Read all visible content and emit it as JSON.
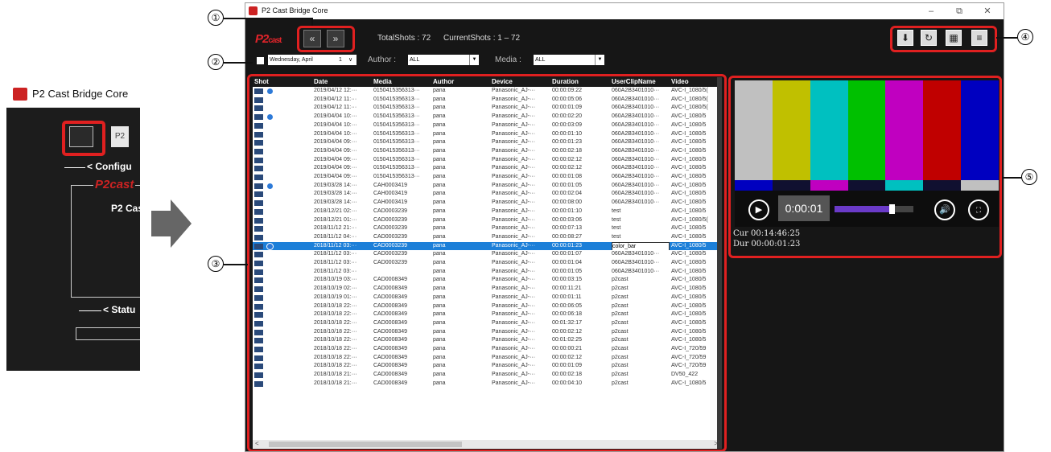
{
  "small_window": {
    "title": "P2 Cast Bridge Core",
    "p2_button": "P2",
    "config_heading": "< Configu",
    "logo": "P2cast",
    "p2cast_label": "P2 Cas",
    "status_heading": "< Statu"
  },
  "main_window": {
    "title": "P2 Cast Bridge Core",
    "minimize": "–",
    "restore": "⧉",
    "close": "✕"
  },
  "header": {
    "logo_main": "P2",
    "logo_sub": "cast",
    "prev_label": "«",
    "next_label": "»",
    "total_shots": "TotalShots :  72",
    "current_shots": "CurrentShots :  1 – 72"
  },
  "filters": {
    "date_value": "Wednesday,     April",
    "date_day": "1",
    "date_arrow": "∨",
    "author_label": "Author :",
    "author_value": "ALL",
    "media_label": "Media :",
    "media_value": "ALL",
    "combo_arrow": "▼"
  },
  "toolbar": {
    "download_icon": "⬇",
    "refresh_icon": "↻",
    "grid_icon": "▦",
    "list_icon": "≡"
  },
  "table": {
    "columns": [
      "Shot",
      "Date",
      "Media",
      "Author",
      "Device",
      "Duration",
      "UserClipName",
      "Video"
    ],
    "rows": [
      {
        "dl": true,
        "date": "2019/04/12 12:···",
        "media": "0150415356313···",
        "author": "pana",
        "device": "Panasonic_AJ-···",
        "duration": "00:00:09:22",
        "clip": "060A2B3401010···",
        "video": "AVC-I_1080/5("
      },
      {
        "dl": false,
        "date": "2019/04/12 11:···",
        "media": "0150415356313···",
        "author": "pana",
        "device": "Panasonic_AJ-···",
        "duration": "00:00:05:06",
        "clip": "060A2B3401010···",
        "video": "AVC-I_1080/5("
      },
      {
        "dl": false,
        "date": "2019/04/12 11:···",
        "media": "0150415356313···",
        "author": "pana",
        "device": "Panasonic_AJ-···",
        "duration": "00:00:01:09",
        "clip": "060A2B3401010···",
        "video": "AVC-I_1080/5("
      },
      {
        "dl": true,
        "date": "2019/04/04 10:···",
        "media": "0150415356313···",
        "author": "pana",
        "device": "Panasonic_AJ-···",
        "duration": "00:00:02:20",
        "clip": "060A2B3401010···",
        "video": "AVC-I_1080/5"
      },
      {
        "dl": false,
        "date": "2019/04/04 10:···",
        "media": "0150415356313···",
        "author": "pana",
        "device": "Panasonic_AJ-···",
        "duration": "00:00:03:09",
        "clip": "060A2B3401010···",
        "video": "AVC-I_1080/5"
      },
      {
        "dl": false,
        "date": "2019/04/04 10:···",
        "media": "0150415356313···",
        "author": "pana",
        "device": "Panasonic_AJ-···",
        "duration": "00:00:01:10",
        "clip": "060A2B3401010···",
        "video": "AVC-I_1080/5"
      },
      {
        "dl": false,
        "date": "2019/04/04 09:···",
        "media": "0150415356313···",
        "author": "pana",
        "device": "Panasonic_AJ-···",
        "duration": "00:00:01:23",
        "clip": "060A2B3401010···",
        "video": "AVC-I_1080/5"
      },
      {
        "dl": false,
        "date": "2019/04/04 09:···",
        "media": "0150415356313···",
        "author": "pana",
        "device": "Panasonic_AJ-···",
        "duration": "00:00:02:18",
        "clip": "060A2B3401010···",
        "video": "AVC-I_1080/5"
      },
      {
        "dl": false,
        "date": "2019/04/04 09:···",
        "media": "0150415356313···",
        "author": "pana",
        "device": "Panasonic_AJ-···",
        "duration": "00:00:02:12",
        "clip": "060A2B3401010···",
        "video": "AVC-I_1080/5"
      },
      {
        "dl": false,
        "date": "2019/04/04 09:···",
        "media": "0150415356313···",
        "author": "pana",
        "device": "Panasonic_AJ-···",
        "duration": "00:00:02:12",
        "clip": "060A2B3401010···",
        "video": "AVC-I_1080/5"
      },
      {
        "dl": false,
        "date": "2019/04/04 09:···",
        "media": "0150415356313···",
        "author": "pana",
        "device": "Panasonic_AJ-···",
        "duration": "00:00:01:08",
        "clip": "060A2B3401010···",
        "video": "AVC-I_1080/5"
      },
      {
        "dl": true,
        "date": "2019/03/28 14:···",
        "media": "CAH0003419",
        "author": "pana",
        "device": "Panasonic_AJ-···",
        "duration": "00:00:01:05",
        "clip": "060A2B3401010···",
        "video": "AVC-I_1080/5"
      },
      {
        "dl": false,
        "date": "2019/03/28 14:···",
        "media": "CAH0003419",
        "author": "pana",
        "device": "Panasonic_AJ-···",
        "duration": "00:00:02:04",
        "clip": "060A2B3401010···",
        "video": "AVC-I_1080/5"
      },
      {
        "dl": false,
        "date": "2019/03/28 14:···",
        "media": "CAH0003419",
        "author": "pana",
        "device": "Panasonic_AJ-···",
        "duration": "00:00:08:00",
        "clip": "060A2B3401010···",
        "video": "AVC-I_1080/5"
      },
      {
        "dl": false,
        "date": "2018/12/21 02:···",
        "media": "CAD0003239",
        "author": "pana",
        "device": "Panasonic_AJ-···",
        "duration": "00:00:01:10",
        "clip": "test",
        "video": "AVC-I_1080/5"
      },
      {
        "dl": false,
        "date": "2018/12/21 01:···",
        "media": "CAD0003239",
        "author": "pana",
        "device": "Panasonic_AJ-···",
        "duration": "00:00:03:06",
        "clip": "test",
        "video": "AVC-I_1080/5("
      },
      {
        "dl": false,
        "date": "2018/11/12 21:···",
        "media": "CAD0003239",
        "author": "pana",
        "device": "Panasonic_AJ-···",
        "duration": "00:00:07:13",
        "clip": "test",
        "video": "AVC-I_1080/5"
      },
      {
        "dl": false,
        "date": "2018/11/12 04:···",
        "media": "CAD0003239",
        "author": "pana",
        "device": "Panasonic_AJ-···",
        "duration": "00:00:08:27",
        "clip": "test",
        "video": "AVC-I_1080/5"
      },
      {
        "dl": true,
        "sel": true,
        "date": "2018/11/12 03:···",
        "media": "CAD0003239",
        "author": "pana",
        "device": "Panasonic_AJ-···",
        "duration": "00:00:01:23",
        "clip": "color_bar",
        "video": "AVC-I_1080/5"
      },
      {
        "dl": false,
        "date": "2018/11/12 03:···",
        "media": "CAD0003239",
        "author": "pana",
        "device": "Panasonic_AJ-···",
        "duration": "00:00:01:07",
        "clip": "060A2B3401010···",
        "video": "AVC-I_1080/5"
      },
      {
        "dl": false,
        "date": "2018/11/12 03:···",
        "media": "CAD0003239",
        "author": "pana",
        "device": "Panasonic_AJ-···",
        "duration": "00:00:01:04",
        "clip": "060A2B3401010···",
        "video": "AVC-I_1080/5"
      },
      {
        "dl": false,
        "date": "2018/11/12 03:···",
        "media": "",
        "author": "pana",
        "device": "Panasonic_AJ-···",
        "duration": "00:00:01:05",
        "clip": "060A2B3401010···",
        "video": "AVC-I_1080/5"
      },
      {
        "dl": false,
        "date": "2018/10/19 03:···",
        "media": "CAD0008349",
        "author": "pana",
        "device": "Panasonic_AJ-···",
        "duration": "00:00:03:15",
        "clip": "p2cast",
        "video": "AVC-I_1080/5"
      },
      {
        "dl": false,
        "date": "2018/10/19 02:···",
        "media": "CAD0008349",
        "author": "pana",
        "device": "Panasonic_AJ-···",
        "duration": "00:00:11:21",
        "clip": "p2cast",
        "video": "AVC-I_1080/5"
      },
      {
        "dl": false,
        "date": "2018/10/19 01:···",
        "media": "CAD0008349",
        "author": "pana",
        "device": "Panasonic_AJ-···",
        "duration": "00:00:01:11",
        "clip": "p2cast",
        "video": "AVC-I_1080/5"
      },
      {
        "dl": false,
        "date": "2018/10/18 22:···",
        "media": "CAD0008349",
        "author": "pana",
        "device": "Panasonic_AJ-···",
        "duration": "00:00:06:05",
        "clip": "p2cast",
        "video": "AVC-I_1080/5"
      },
      {
        "dl": false,
        "date": "2018/10/18 22:···",
        "media": "CAD0008349",
        "author": "pana",
        "device": "Panasonic_AJ-···",
        "duration": "00:00:06:18",
        "clip": "p2cast",
        "video": "AVC-I_1080/5"
      },
      {
        "dl": false,
        "date": "2018/10/18 22:···",
        "media": "CAD0008349",
        "author": "pana",
        "device": "Panasonic_AJ-···",
        "duration": "00:01:32:17",
        "clip": "p2cast",
        "video": "AVC-I_1080/5"
      },
      {
        "dl": false,
        "date": "2018/10/18 22:···",
        "media": "CAD0008349",
        "author": "pana",
        "device": "Panasonic_AJ-···",
        "duration": "00:00:02:12",
        "clip": "p2cast",
        "video": "AVC-I_1080/5"
      },
      {
        "dl": false,
        "date": "2018/10/18 22:···",
        "media": "CAD0008349",
        "author": "pana",
        "device": "Panasonic_AJ-···",
        "duration": "00:01:02:25",
        "clip": "p2cast",
        "video": "AVC-I_1080/5"
      },
      {
        "dl": false,
        "date": "2018/10/18 22:···",
        "media": "CAD0008349",
        "author": "pana",
        "device": "Panasonic_AJ-···",
        "duration": "00:00:00:21",
        "clip": "p2cast",
        "video": "AVC-I_720/59"
      },
      {
        "dl": false,
        "date": "2018/10/18 22:···",
        "media": "CAD0008349",
        "author": "pana",
        "device": "Panasonic_AJ-···",
        "duration": "00:00:02:12",
        "clip": "p2cast",
        "video": "AVC-I_720/59"
      },
      {
        "dl": false,
        "date": "2018/10/18 22:···",
        "media": "CAD0008349",
        "author": "pana",
        "device": "Panasonic_AJ-···",
        "duration": "00:00:01:09",
        "clip": "p2cast",
        "video": "AVC-I_720/59"
      },
      {
        "dl": false,
        "date": "2018/10/18 21:···",
        "media": "CAD0008349",
        "author": "pana",
        "device": "Panasonic_AJ-···",
        "duration": "00:00:02:18",
        "clip": "p2cast",
        "video": "DV50_422"
      },
      {
        "dl": false,
        "date": "2018/10/18 21:···",
        "media": "CAD0008349",
        "author": "pana",
        "device": "Panasonic_AJ-···",
        "duration": "00:00:04:10",
        "clip": "p2cast",
        "video": "AVC-I_1080/5"
      }
    ],
    "scroll_left": "<",
    "scroll_right": ">"
  },
  "player": {
    "bar_colors": [
      "#c0c0c0",
      "#c0c000",
      "#00c0c0",
      "#00c000",
      "#c000c0",
      "#c00000",
      "#0000c0"
    ],
    "strip_colors": [
      "#0000c0",
      "#101030",
      "#c000c0",
      "#101030",
      "#00c0c0",
      "#101030",
      "#c0c0c0"
    ],
    "play_icon": "▶",
    "time": "0:00:01",
    "progress": 0.72,
    "volume_icon": "🔊",
    "fullscreen_icon": "⛶",
    "cur_timecode": "Cur 00:14:46:25",
    "dur_timecode": "Dur 00:00:01:23"
  },
  "callouts": {
    "c1": "①",
    "c2": "②",
    "c3": "③",
    "c4": "④",
    "c5": "⑤"
  }
}
